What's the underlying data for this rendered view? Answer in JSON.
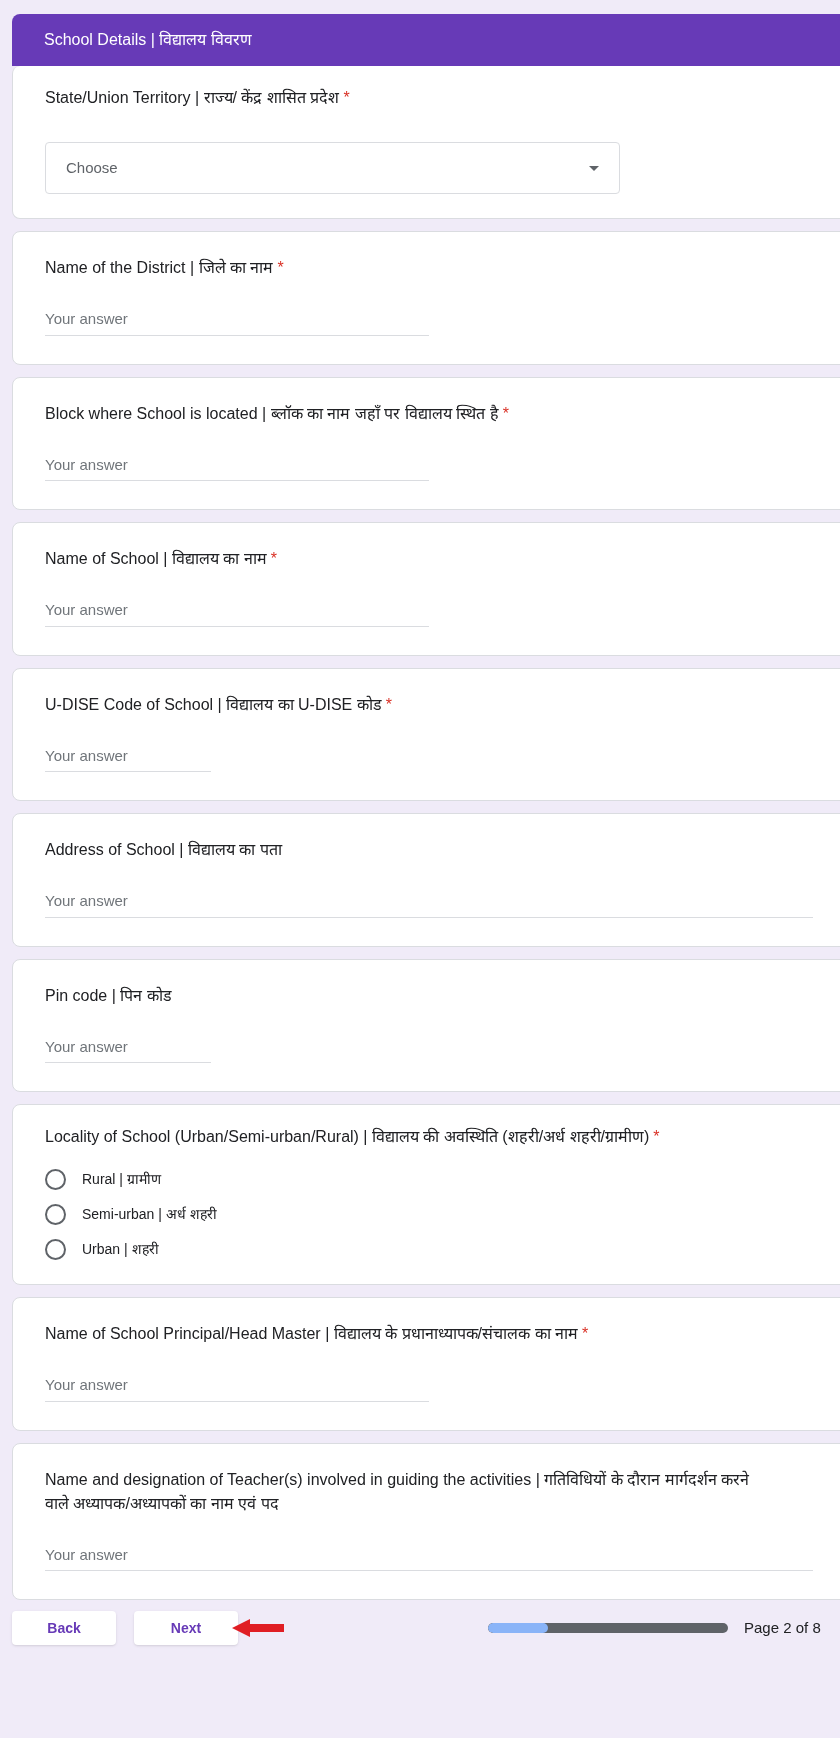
{
  "section_title": "School Details | विद्यालय विवरण",
  "questions": [
    {
      "kind": "dropdown",
      "title": "State/Union Territory | राज्य/ केंद्र शासित प्रदेश",
      "required_mark": "*",
      "placeholder": "Choose"
    },
    {
      "kind": "text_medium",
      "title": "Name of the District | जिले का नाम",
      "required_mark": "*",
      "placeholder": "Your answer"
    },
    {
      "kind": "text_medium",
      "title": "Block where School is located | ब्लॉक का नाम जहाँ पर विद्यालय स्थित है",
      "required_mark": "*",
      "placeholder": "Your answer"
    },
    {
      "kind": "text_medium",
      "title": "Name of School | विद्यालय का नाम",
      "required_mark": "*",
      "placeholder": "Your answer"
    },
    {
      "kind": "text_small",
      "title": "U-DISE Code of School | विद्यालय का U-DISE कोड",
      "required_mark": "*",
      "placeholder": "Your answer"
    },
    {
      "kind": "text_long",
      "title": "Address of School | विद्यालय का पता",
      "placeholder": "Your answer"
    },
    {
      "kind": "text_small",
      "title": "Pin code | पिन कोड",
      "placeholder": "Your answer"
    },
    {
      "kind": "radio",
      "title": "Locality of School (Urban/Semi-urban/Rural) | विद्यालय की अवस्थिति (शहरी/अर्ध शहरी/ग्रामीण)",
      "required_mark": "*",
      "options": [
        {
          "label": "Rural | ग्रामीण",
          "selected": false
        },
        {
          "label": "Semi-urban | अर्ध शहरी",
          "selected": false
        },
        {
          "label": "Urban | शहरी",
          "selected": false
        }
      ]
    },
    {
      "kind": "text_medium",
      "title": "Name of School Principal/Head Master | विद्यालय के प्रधानाध्यापक/संचालक का नाम",
      "required_mark": "*",
      "placeholder": "Your answer"
    },
    {
      "kind": "text_long",
      "title": "Name and designation of Teacher(s) involved in guiding the activities | गतिविधियों के दौरान मार्गदर्शन करने वाले अध्यापक/अध्यापकों का नाम एवं पद",
      "placeholder": "Your answer"
    }
  ],
  "footer": {
    "back": "Back",
    "next": "Next",
    "progress": {
      "level": 0.25
    },
    "page_label": "Page 2 of 8"
  }
}
